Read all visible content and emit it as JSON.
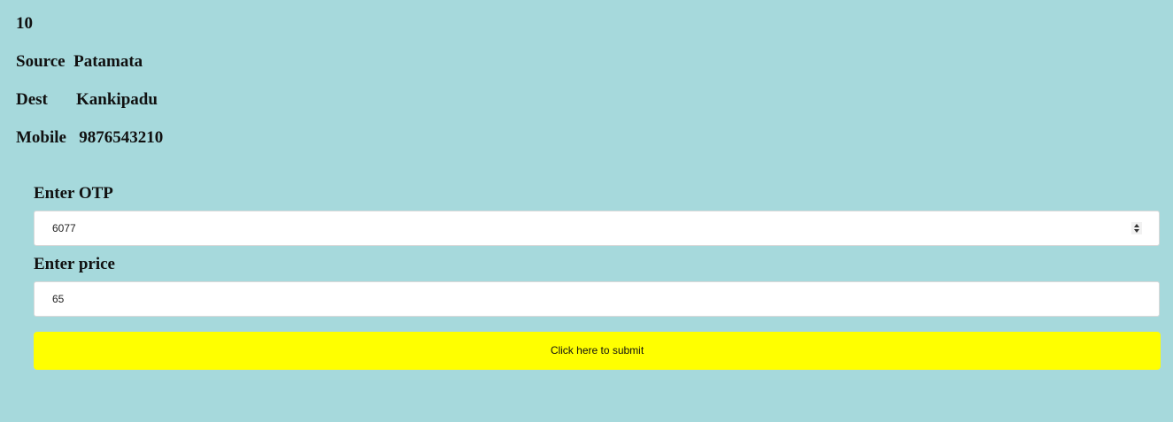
{
  "ride": {
    "id": "10",
    "source_label": "Source",
    "source_value": "Patamata",
    "dest_label": "Dest",
    "dest_value": "Kankipadu",
    "mobile_label": "Mobile",
    "mobile_value": "9876543210"
  },
  "form": {
    "otp_label": "Enter OTP",
    "otp_value": "6077",
    "price_label": "Enter price",
    "price_value": "65",
    "submit_label": "Click here to submit"
  },
  "colors": {
    "background": "#a6d9dc",
    "submit_button": "#ffff00"
  }
}
